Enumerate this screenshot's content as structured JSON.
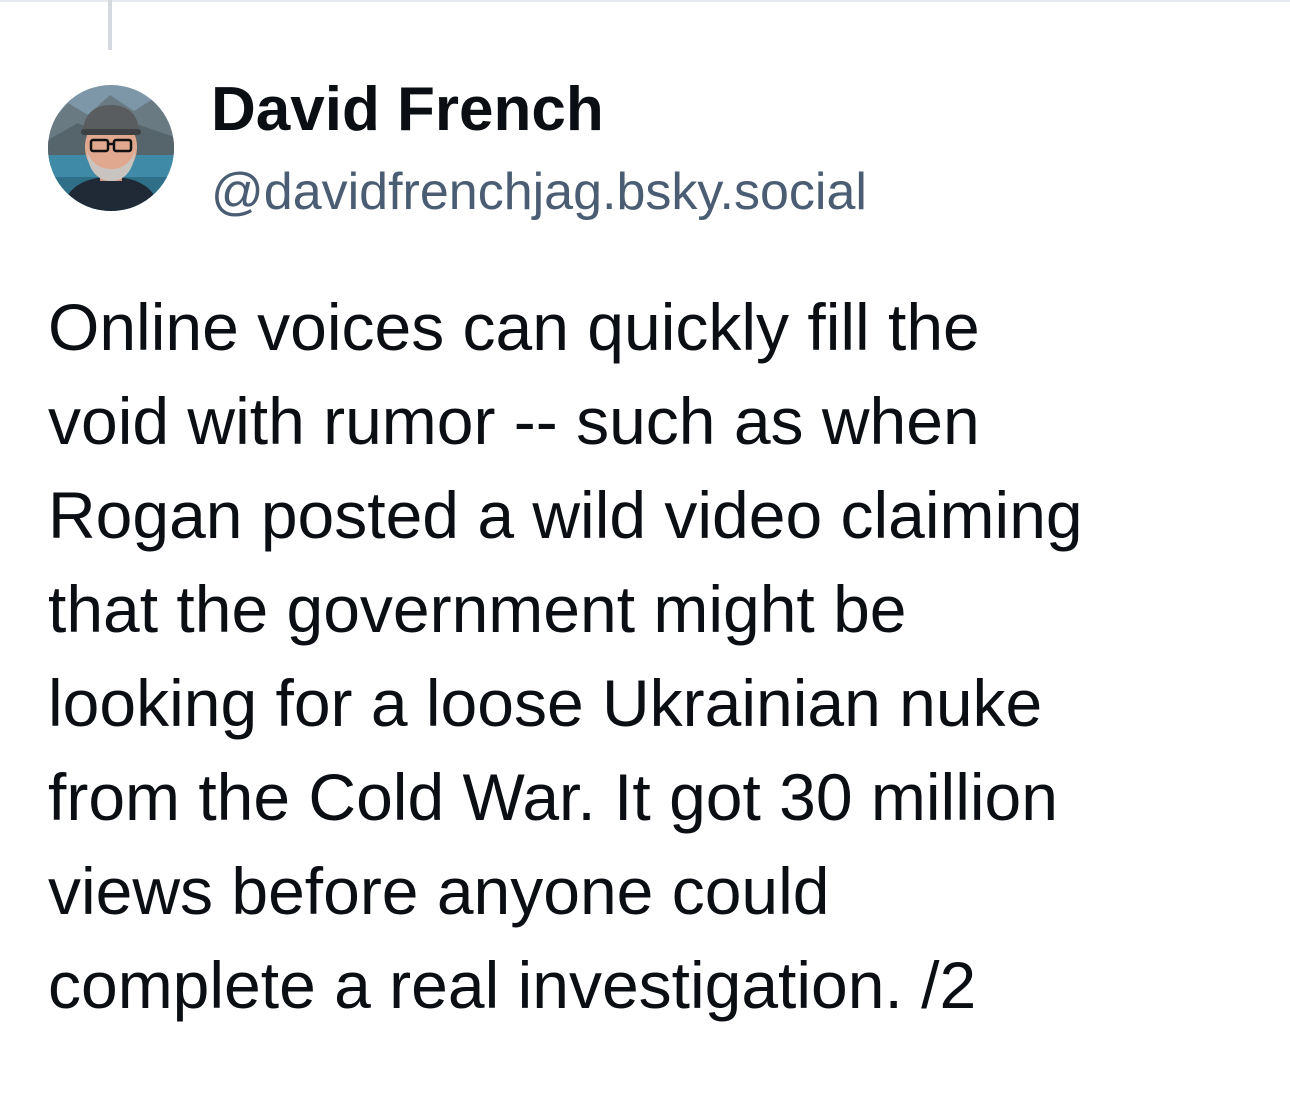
{
  "post": {
    "author": {
      "display_name": "David French",
      "handle": "@davidfrenchjag.bsky.social",
      "avatar": "user-avatar-photo"
    },
    "body_lines": [
      "Online voices can quickly fill the",
      "void with rumor -- such as when",
      "Rogan posted a wild video claiming",
      "that the government might be",
      "looking for a loose Ukrainian nuke",
      "from the Cold War. It got 30 million",
      "views before anyone could",
      "complete a real investigation. /2"
    ]
  },
  "colors": {
    "name": "#0b0f14",
    "handle": "#4b5d72",
    "body": "#0b0f14",
    "thread_line": "#d4d9e0",
    "divider": "#e6e9ee"
  }
}
